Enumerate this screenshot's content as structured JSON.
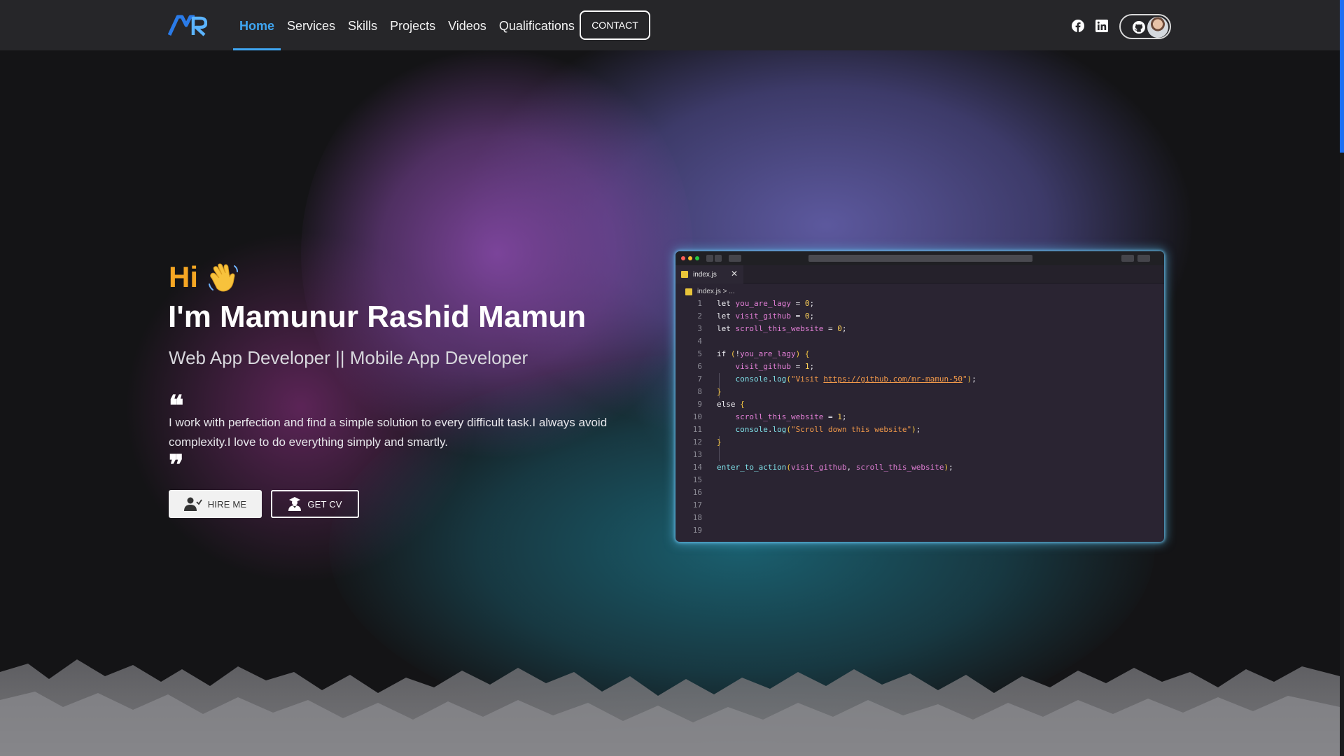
{
  "nav": {
    "items": [
      {
        "label": "Home",
        "active": true
      },
      {
        "label": "Services"
      },
      {
        "label": "Skills"
      },
      {
        "label": "Projects"
      },
      {
        "label": "Videos"
      },
      {
        "label": "Qualifications"
      }
    ],
    "contact_label": "CONTACT",
    "social_icons": [
      "facebook-icon",
      "linkedin-icon",
      "github-icon"
    ]
  },
  "hero": {
    "greeting": "Hi",
    "name": "I'm Mamunur Rashid Mamun",
    "role": "Web App Developer || Mobile App Developer",
    "quote_open": "❝",
    "quote_close": "❞",
    "intro": "I work with perfection and find a simple solution to every difficult task.I always avoid complexity.I love to do everything simply and smartly.",
    "hire_label": "HIRE ME",
    "cv_label": "GET CV"
  },
  "editor": {
    "tab_label": "index.js",
    "tab_close": "✕",
    "breadcrumb": "index.js > ...",
    "line_numbers": [
      "1",
      "2",
      "3",
      "4",
      "5",
      "6",
      "7",
      "8",
      "9",
      "10",
      "11",
      "12",
      "13",
      "14",
      "15",
      "16",
      "17",
      "18",
      "19"
    ],
    "code_lines": [
      "let you_are_lagy = 0;",
      "let visit_github = 0;",
      "let scroll_this_website = 0;",
      "",
      "if (!you_are_lagy) {",
      "    visit_github = 1;",
      "    console.log(\"Visit https://github.com/mr-mamun-50\");",
      "}",
      "else {",
      "    scroll_this_website = 1;",
      "    console.log(\"Scroll down this website\");",
      "}",
      "",
      "enter_to_action(visit_github, scroll_this_website);",
      "",
      "",
      "",
      "",
      ""
    ]
  },
  "colors": {
    "accent": "#3fa6f2",
    "greeting": "#f5a623",
    "navbar_bg": "#262629",
    "scroll_thumb": "#1d6ff2"
  }
}
